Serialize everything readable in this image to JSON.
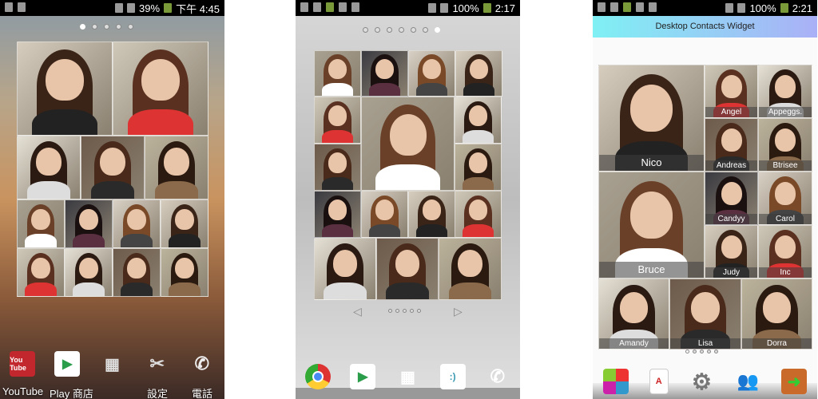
{
  "screens": [
    {
      "status": {
        "battery": "39%",
        "time": "下午 4:45"
      },
      "dock": [
        {
          "label": "YouTube",
          "icon": "youtube-icon"
        },
        {
          "label": "Play 商店",
          "icon": "play-store-icon"
        },
        {
          "label": "",
          "icon": "app-drawer-icon"
        },
        {
          "label": "設定",
          "icon": "settings-icon"
        },
        {
          "label": "電話",
          "icon": "phone-icon"
        }
      ],
      "youtube_glyph": "You Tube"
    },
    {
      "status": {
        "battery": "100%",
        "time": "2:17"
      },
      "dock": [
        {
          "icon": "chrome-icon"
        },
        {
          "icon": "play-store-icon"
        },
        {
          "icon": "app-drawer-icon"
        },
        {
          "icon": "messaging-icon",
          "glyph": ":)"
        },
        {
          "icon": "phone-icon"
        }
      ]
    },
    {
      "status": {
        "battery": "100%",
        "time": "2:21"
      },
      "title": "Desktop Contacts Widget",
      "contacts": [
        "Nico",
        "Angel",
        "Appeggs.",
        "Andreas",
        "Btrisee",
        "Bruce",
        "Candyy",
        "Carol",
        "Judy",
        "Inc",
        "Amandy",
        "Lisa",
        "Dorra"
      ],
      "dock": [
        {
          "icon": "puzzle-icon"
        },
        {
          "icon": "document-icon"
        },
        {
          "icon": "gear-icon"
        },
        {
          "icon": "contacts-icon"
        },
        {
          "icon": "exit-door-icon"
        }
      ]
    }
  ]
}
